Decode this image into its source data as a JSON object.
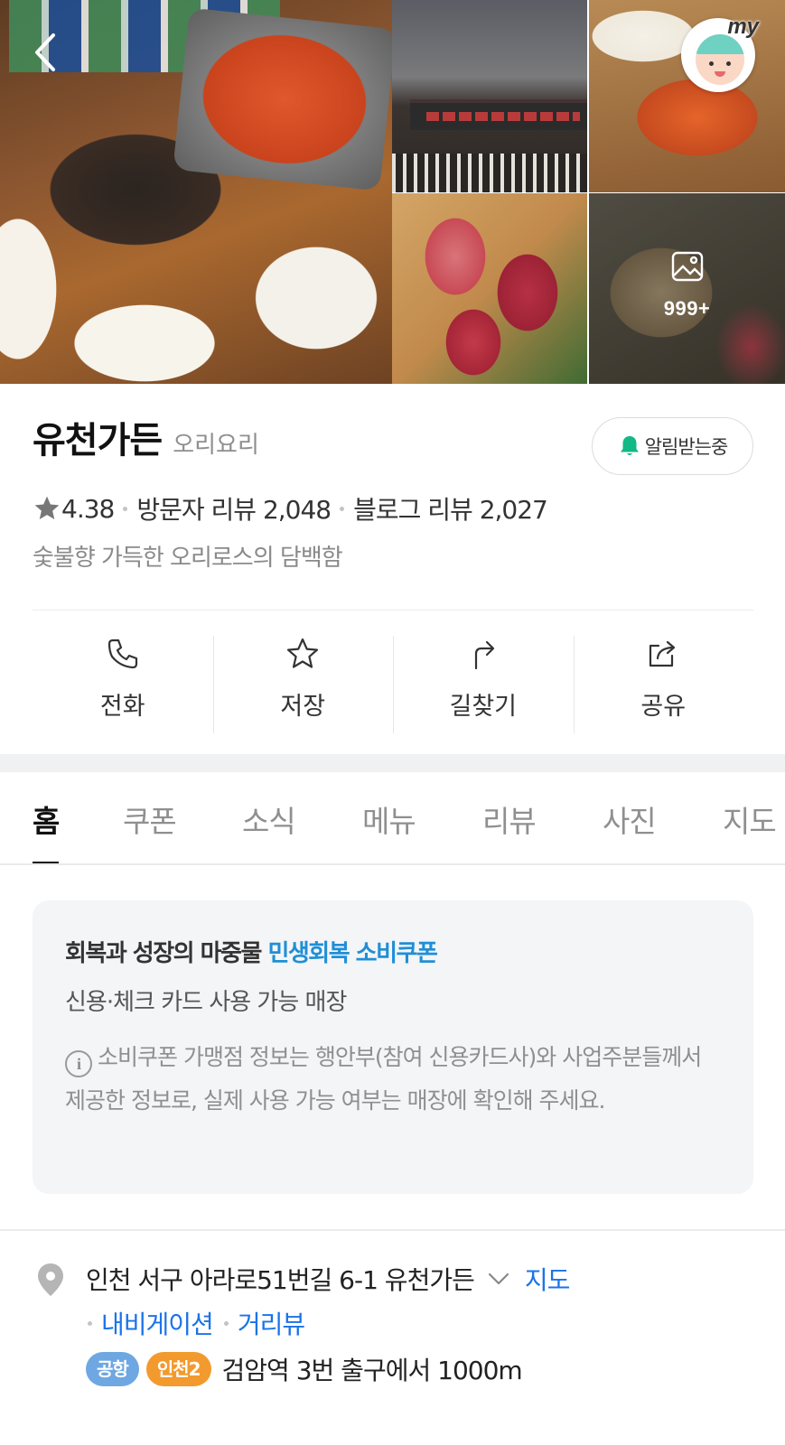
{
  "photos": {
    "more_count": "999+",
    "my_label": "my"
  },
  "place": {
    "name": "유천가든",
    "category": "오리요리",
    "alarm_label": "알림받는중",
    "rating": "4.38",
    "visitor_reviews": "방문자 리뷰 2,048",
    "blog_reviews": "블로그 리뷰 2,027",
    "description": "숯불향 가득한 오리로스의 담백함"
  },
  "actions": [
    {
      "label": "전화",
      "icon": "phone-icon"
    },
    {
      "label": "저장",
      "icon": "star-icon"
    },
    {
      "label": "길찾기",
      "icon": "directions-icon"
    },
    {
      "label": "공유",
      "icon": "share-icon"
    }
  ],
  "tabs": [
    {
      "label": "홈",
      "active": true
    },
    {
      "label": "쿠폰"
    },
    {
      "label": "소식"
    },
    {
      "label": "메뉴"
    },
    {
      "label": "리뷰"
    },
    {
      "label": "사진"
    },
    {
      "label": "지도"
    }
  ],
  "coupon_card": {
    "title_prefix": "회복과 성장의 마중물",
    "title_highlight": "민생회복 소비쿠폰",
    "subtitle": "신용·체크 카드 사용 가능 매장",
    "note": "소비쿠폰 가맹점 정보는 행안부(참여 신용카드사)와 사업주분들께서 제공한 정보로, 실제 사용 가능 여부는 매장에 확인해 주세요."
  },
  "address": {
    "text": "인천 서구 아라로51번길 6-1 유천가든",
    "map_link": "지도",
    "navigation_link": "내비게이션",
    "street_view_link": "거리뷰",
    "badge_airport": "공항",
    "badge_line": "인천2",
    "directions": "검암역 3번 출구에서 1000m"
  },
  "colors": {
    "accent_link": "#1b73e8",
    "coupon_highlight": "#1f8fd6",
    "alarm_green": "#12b886",
    "badge_airport": "#6fa7e2",
    "badge_line": "#f29a2e"
  }
}
